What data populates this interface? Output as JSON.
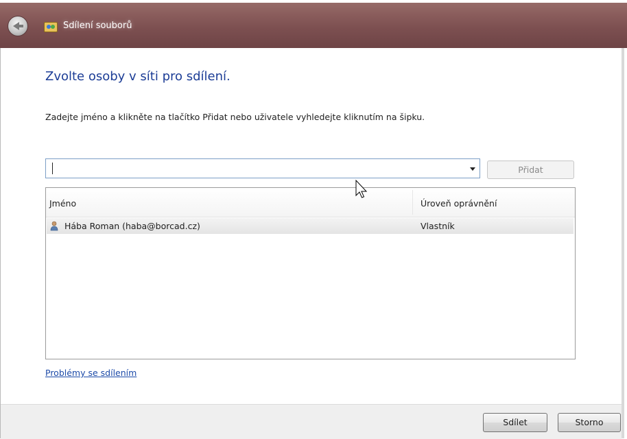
{
  "window": {
    "title": "Sdílení souborů"
  },
  "dialog": {
    "heading": "Zvolte osoby v síti pro sdílení.",
    "instruction": "Zadejte jméno a klikněte na tlačítko Přidat nebo uživatele vyhledejte kliknutím na šipku.",
    "name_input": {
      "value": "",
      "placeholder": ""
    },
    "add_button": "Přidat",
    "list": {
      "columns": {
        "name": "Jméno",
        "permission": "Úroveň oprávnění"
      },
      "rows": [
        {
          "name": "Hába Roman (haba@borcad.cz)",
          "permission": "Vlastník"
        }
      ]
    },
    "help_link": "Problémy se sdílením"
  },
  "footer": {
    "share_button": "Sdílet",
    "cancel_button": "Storno"
  },
  "colors": {
    "titlebar": "#7c4f50",
    "heading": "#1c3d96",
    "link": "#1c4aa8"
  }
}
